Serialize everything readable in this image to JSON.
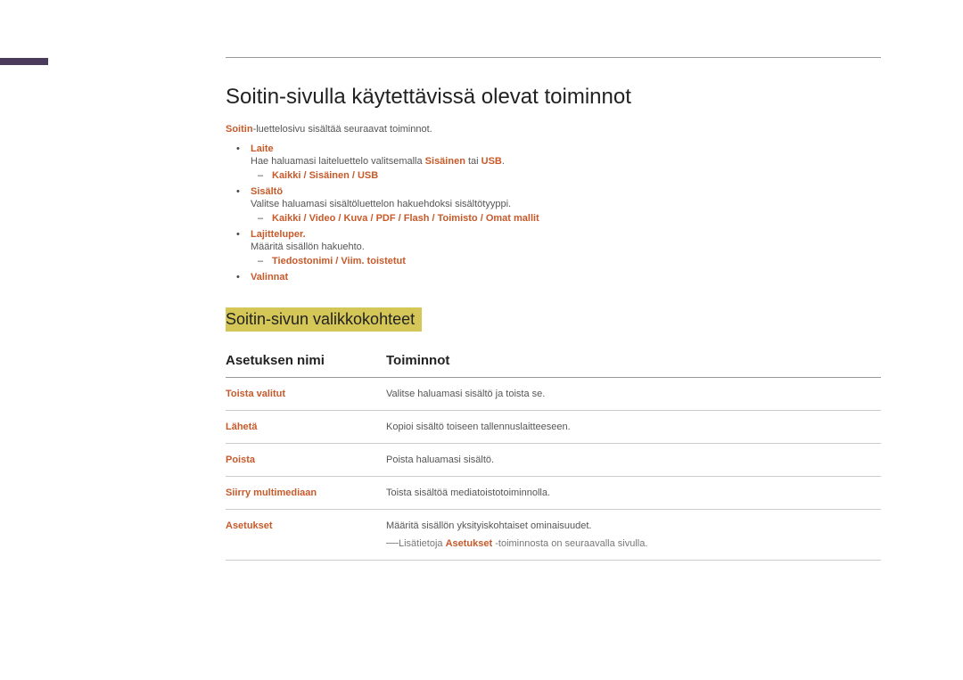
{
  "heading": "Soitin-sivulla käytettävissä olevat toiminnot",
  "intro": {
    "prefix": "Soitin",
    "rest": "-luettelosivu sisältää seuraavat toiminnot."
  },
  "bullets": {
    "laite": {
      "title": "Laite",
      "desc_pre": "Hae haluamasi laiteluettelo valitsemalla ",
      "desc_hl1": "Sisäinen",
      "desc_mid": " tai ",
      "desc_hl2": "USB",
      "desc_post": ".",
      "sub": "Kaikki / Sisäinen / USB"
    },
    "sisalto": {
      "title": "Sisältö",
      "desc": "Valitse haluamasi sisältöluettelon hakuehdoksi sisältötyyppi.",
      "sub": "Kaikki / Video / Kuva / PDF / Flash / Toimisto / Omat mallit"
    },
    "lajittelu": {
      "title": "Lajitteluper.",
      "desc": "Määritä sisällön hakuehto.",
      "sub": "Tiedostonimi / Viim. toistetut"
    },
    "valinnat": {
      "title": "Valinnat"
    }
  },
  "section_title": "Soitin-sivun valikkokohteet",
  "table": {
    "col1": "Asetuksen nimi",
    "col2": "Toiminnot",
    "rows": [
      {
        "name": "Toista valitut",
        "desc": "Valitse haluamasi sisältö ja toista se."
      },
      {
        "name": "Lähetä",
        "desc": "Kopioi sisältö toiseen tallennuslaitteeseen."
      },
      {
        "name": "Poista",
        "desc": "Poista haluamasi sisältö."
      },
      {
        "name": "Siirry multimediaan",
        "desc": "Toista sisältöä mediatoistotoiminnolla."
      },
      {
        "name": "Asetukset",
        "desc": "Määritä sisällön yksityiskohtaiset ominaisuudet."
      }
    ],
    "note_pre": "Lisätietoja ",
    "note_hl": "Asetukset",
    "note_post": " -toiminnosta on seuraavalla sivulla."
  }
}
